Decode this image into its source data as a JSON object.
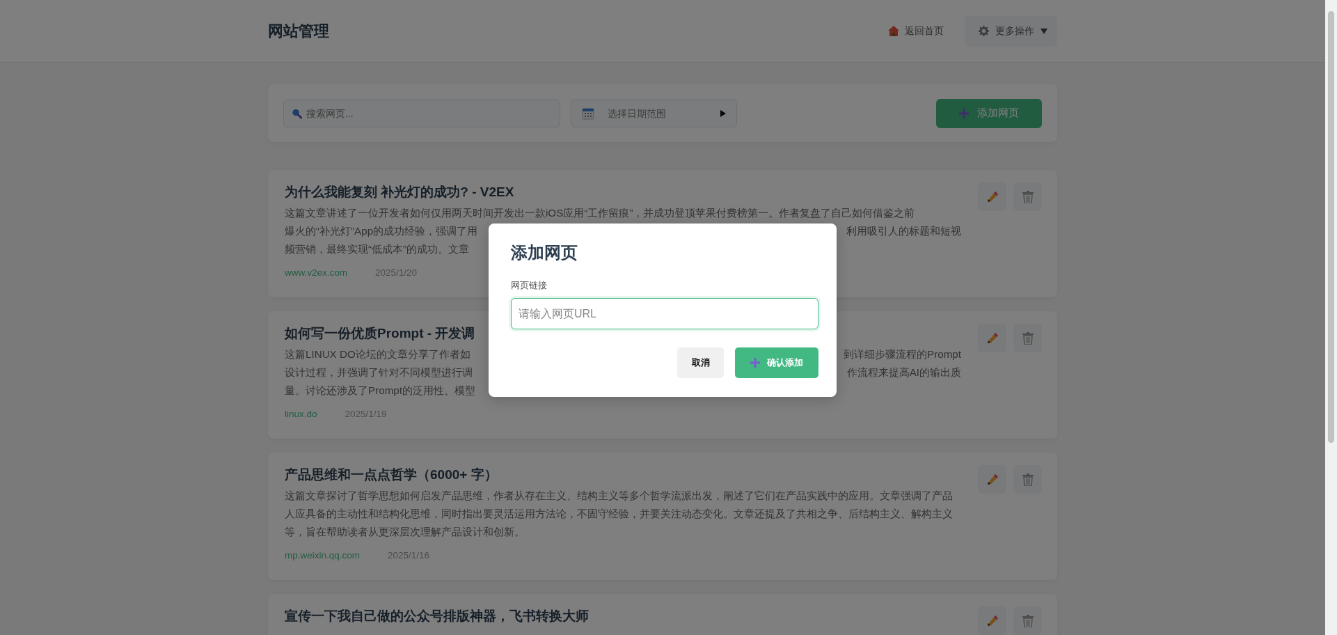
{
  "header": {
    "title": "网站管理",
    "home_link": "返回首页",
    "more_button": "更多操作"
  },
  "toolbar": {
    "search": {
      "placeholder": "搜索网页..."
    },
    "date_range": {
      "placeholder": "选择日期范围"
    },
    "add_button": "添加网页"
  },
  "articles": [
    {
      "title": "为什么我能复刻 补光灯的成功? - V2EX",
      "description_lines": [
        {
          "left": "这篇文章讲述了一位开发者如何仅用两天时间开发出一款iOS应用“工作留痕”，并成功登顶苹果付费榜第一。作者复盘了自己如何借鉴之前"
        },
        {
          "left": "爆火的“补光灯”App的成功经验，强调了用",
          "right": "利用吸引人的标题和短视"
        },
        {
          "left": "频营销，最终实现“低成本”的成功。文章"
        }
      ],
      "domain": "www.v2ex.com",
      "date": "2025/1/20"
    },
    {
      "title": "如何写一份优质Prompt - 开发调",
      "description_lines": [
        {
          "left": "这篇LINUX DO论坛的文章分享了作者如",
          "right": "到详细步骤流程的Prompt"
        },
        {
          "left": "设计过程，并强调了针对不同模型进行调",
          "right": "作流程来提高AI的输出质"
        },
        {
          "left": "量。讨论还涉及了Prompt的泛用性、模型"
        }
      ],
      "domain": "linux.do",
      "date": "2025/1/19"
    },
    {
      "title": "产品思维和一点点哲学（6000+ 字）",
      "description": "这篇文章探讨了哲学思想如何启发产品思维，作者从存在主义、结构主义等多个哲学流派出发，阐述了它们在产品实践中的应用。文章强调了产品人应具备的主动性和结构化思维，同时指出要灵活运用方法论，不固守经验，并要关注动态变化。文章还提及了共相之争、后结构主义、解构主义等，旨在帮助读者从更深层次理解产品设计和创新。",
      "domain": "mp.weixin.qq.com",
      "date": "2025/1/16"
    },
    {
      "title": "宣传一下我自己做的公众号排版神器，飞书转换大师"
    }
  ],
  "modal": {
    "title": "添加网页",
    "field_label": "网页链接",
    "url_field": {
      "placeholder": "请输入网页URL",
      "focused": true
    },
    "cancel_button": "取消",
    "confirm_button": "确认添加"
  }
}
